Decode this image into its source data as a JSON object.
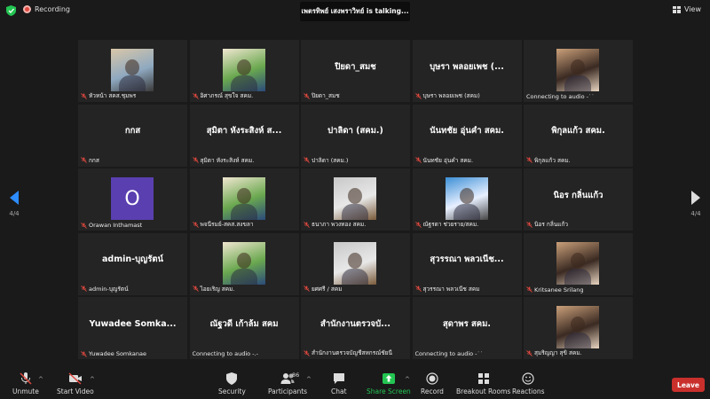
{
  "topbar": {
    "recording_label": "Recording",
    "talking_text": "เพตรทิพย์ เสงพราวิทย์ is  talking...",
    "view_label": "View"
  },
  "pager": {
    "left_label": "4/4",
    "right_label": "4/4"
  },
  "tiles": [
    {
      "display": "",
      "name": "หัวหน้า สคส.ชุมพร",
      "video": true
    },
    {
      "display": "",
      "name": "อิศาภรณ์ สุขใจ สคม.",
      "video": true
    },
    {
      "display": "ปิยดา_สมช",
      "name": "ปิยดา_สมช",
      "video": false
    },
    {
      "display": "บุษรา  พลอยเพช (...",
      "name": "บุษรา พลอยเพช (สคม)",
      "video": false
    },
    {
      "display": "",
      "name": "Connecting to audio -˙˙",
      "video": true
    },
    {
      "display": "กกส",
      "name": "กกส",
      "video": false
    },
    {
      "display": "สุมิตา หังระสิงห์ ส...",
      "name": "สุมิตา หังระสิงห์ สคม.",
      "video": false
    },
    {
      "display": "ปาลิดา (สคม.)",
      "name": "ปาลิดา (สคม.)",
      "video": false
    },
    {
      "display": "นันทชัย อุ่นคำ สคม.",
      "name": "นันทชัย อุ่นคำ สคม.",
      "video": false
    },
    {
      "display": "พิกุลแก้ว สคม.",
      "name": "พิกุลแก้ว สคม.",
      "video": false
    },
    {
      "display": "",
      "name": "Orawan Inthamast",
      "video": false,
      "avatar": "O"
    },
    {
      "display": "",
      "name": "พจนีรมย์-สคส.สงขลา",
      "video": true
    },
    {
      "display": "",
      "name": "ธนาภา พวงทอง สคม.",
      "video": true
    },
    {
      "display": "",
      "name": "ณัฐรดา ช่วยราย/สคม.",
      "video": true
    },
    {
      "display": "นิอร  กลิ่นแก้ว",
      "name": "นิอร  กลิ่นแก้ว",
      "video": false
    },
    {
      "display": "admin-บุญรัตน์",
      "name": "admin-บุญรัตน์",
      "video": false
    },
    {
      "display": "",
      "name": "ไอยเริญ สคม.",
      "video": true
    },
    {
      "display": "",
      "name": "ยศศรี / สคม",
      "video": true
    },
    {
      "display": "สุวรรณา พลวเนีช...",
      "name": "สุวรรณา พลวเนีช สคม",
      "video": false
    },
    {
      "display": "",
      "name": "Kritsanee Srilang",
      "video": true
    },
    {
      "display": "Yuwadee  Somka...",
      "name": "Yuwadee Somkanae",
      "video": false
    },
    {
      "display": "ณัฐวดี เก้าล้ม สคม",
      "name": "Connecting to audio -.-",
      "video": false
    },
    {
      "display": "สำนักงานตรวจบั...",
      "name": "สำนักงานตรวจบัญชีสหกรณ์ชัยนี",
      "video": false
    },
    {
      "display": "สุดาพร สคม.",
      "name": "Connecting to audio -˙˙",
      "video": false
    },
    {
      "display": "",
      "name": "สุมริญญา สุขิ สคม.",
      "video": true
    }
  ],
  "toolbar": {
    "unmute": "Unmute",
    "start_video": "Start Video",
    "security": "Security",
    "participants": "Participants",
    "participants_count": "86",
    "chat": "Chat",
    "share_screen": "Share Screen",
    "record": "Record",
    "breakout_rooms": "Breakout Rooms",
    "reactions": "Reactions",
    "leave": "Leave"
  },
  "colors": {
    "accent": "#2d8cff",
    "share_green": "#23c552",
    "leave_red": "#c9302c",
    "tile_bg": "#242424",
    "mute_red": "#e0483e"
  }
}
